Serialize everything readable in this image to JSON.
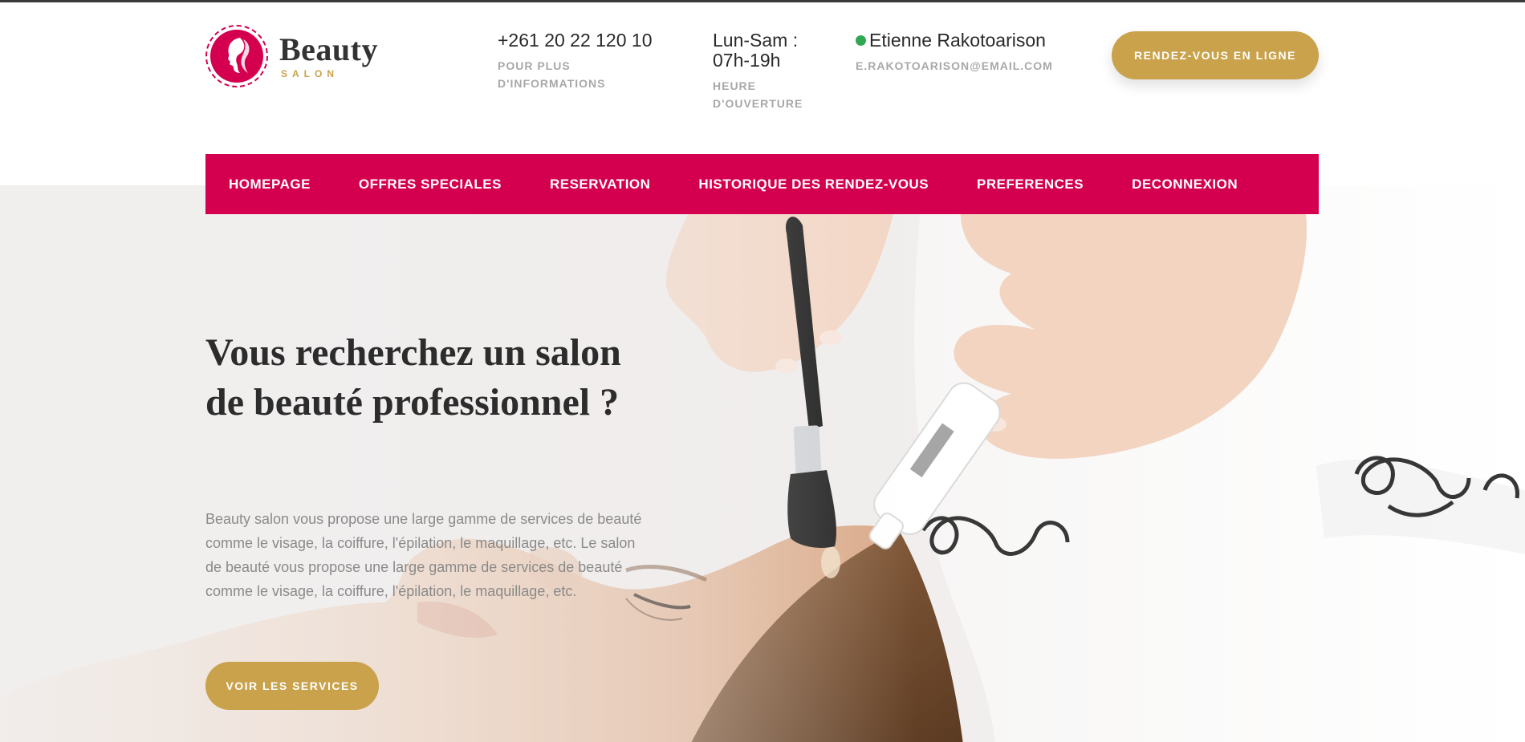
{
  "brand": {
    "name": "Beauty",
    "sub": "SALON",
    "color": "#d4004f",
    "accent": "#c9a24b"
  },
  "header": {
    "phone": "+261 20 22 120 10",
    "phone_caption": "POUR PLUS D'INFORMATIONS",
    "hours_days": "Lun-Sam :",
    "hours_time": "07h-19h",
    "hours_caption": "HEURE D'OUVERTURE",
    "user_name": "Etienne Rakotoarison",
    "user_email": "E.RAKOTOARISON@EMAIL.COM",
    "cta_label": "RENDEZ-VOUS EN LIGNE"
  },
  "nav": {
    "items": [
      {
        "label": "HOMEPAGE"
      },
      {
        "label": "OFFRES SPECIALES"
      },
      {
        "label": "RESERVATION"
      },
      {
        "label": "HISTORIQUE DES RENDEZ-VOUS"
      },
      {
        "label": "PREFERENCES"
      },
      {
        "label": "DECONNEXION"
      }
    ]
  },
  "hero": {
    "title": "Vous recherchez un salon de beauté professionnel ?",
    "text": "Beauty salon vous propose une large gamme de services de beauté comme le visage, la coiffure, l'épilation, le maquillage, etc. Le salon de beauté vous propose une large gamme de services de beauté comme le visage, la coiffure, l'épilation, le maquillage, etc.",
    "cta_label": "VOIR LES SERVICES"
  }
}
